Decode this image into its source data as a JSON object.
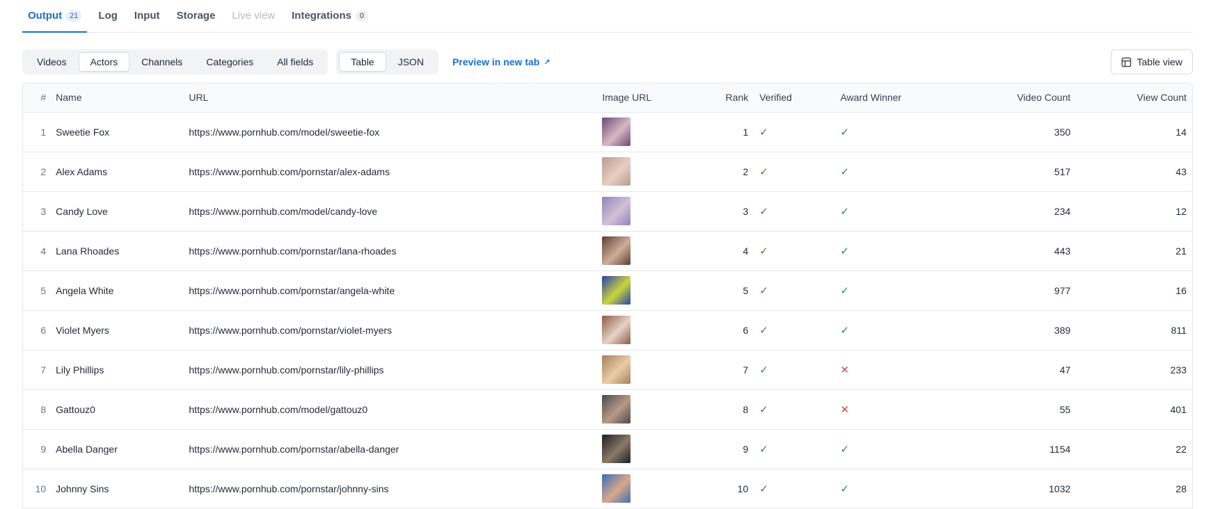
{
  "tabs": [
    {
      "label": "Output",
      "badge": "21",
      "active": true
    },
    {
      "label": "Log"
    },
    {
      "label": "Input"
    },
    {
      "label": "Storage"
    },
    {
      "label": "Live view",
      "disabled": true
    },
    {
      "label": "Integrations",
      "badge": "0"
    }
  ],
  "toolbar": {
    "views": [
      "Videos",
      "Actors",
      "Channels",
      "Categories",
      "All fields"
    ],
    "active_view": "Actors",
    "formats": [
      "Table",
      "JSON"
    ],
    "active_format": "Table",
    "preview_label": "Preview in new tab",
    "table_view_label": "Table view"
  },
  "table": {
    "columns": [
      "#",
      "Name",
      "URL",
      "Image URL",
      "Rank",
      "Verified",
      "Award Winner",
      "Video Count",
      "View Count"
    ],
    "rows": [
      {
        "idx": "1",
        "name": "Sweetie Fox",
        "url": "https://www.pornhub.com/model/sweetie-fox",
        "rank": "1",
        "verified": true,
        "award": true,
        "videos": "350",
        "views": "14",
        "thumb": [
          "#6a4a72",
          "#d9b7c4"
        ]
      },
      {
        "idx": "2",
        "name": "Alex Adams",
        "url": "https://www.pornhub.com/pornstar/alex-adams",
        "rank": "2",
        "verified": true,
        "award": true,
        "videos": "517",
        "views": "43",
        "thumb": [
          "#b89a90",
          "#e7cfc4"
        ]
      },
      {
        "idx": "3",
        "name": "Candy Love",
        "url": "https://www.pornhub.com/model/candy-love",
        "rank": "3",
        "verified": true,
        "award": true,
        "videos": "234",
        "views": "12",
        "thumb": [
          "#8f86b8",
          "#d2c0d8"
        ]
      },
      {
        "idx": "4",
        "name": "Lana Rhoades",
        "url": "https://www.pornhub.com/pornstar/lana-rhoades",
        "rank": "4",
        "verified": true,
        "award": true,
        "videos": "443",
        "views": "21",
        "thumb": [
          "#5b4036",
          "#cfae98"
        ]
      },
      {
        "idx": "5",
        "name": "Angela White",
        "url": "https://www.pornhub.com/pornstar/angela-white",
        "rank": "5",
        "verified": true,
        "award": true,
        "videos": "977",
        "views": "16",
        "thumb": [
          "#2b3fb0",
          "#c9d63a"
        ]
      },
      {
        "idx": "6",
        "name": "Violet Myers",
        "url": "https://www.pornhub.com/pornstar/violet-myers",
        "rank": "6",
        "verified": true,
        "award": true,
        "videos": "389",
        "views": "811",
        "thumb": [
          "#8a5a48",
          "#e8d2c6"
        ]
      },
      {
        "idx": "7",
        "name": "Lily Phillips",
        "url": "https://www.pornhub.com/pornstar/lily-phillips",
        "rank": "7",
        "verified": true,
        "award": false,
        "videos": "47",
        "views": "233",
        "thumb": [
          "#a8805a",
          "#e9cda8"
        ]
      },
      {
        "idx": "8",
        "name": "Gattouz0",
        "url": "https://www.pornhub.com/model/gattouz0",
        "rank": "8",
        "verified": true,
        "award": false,
        "videos": "55",
        "views": "401",
        "thumb": [
          "#4a4a4a",
          "#b89a88"
        ]
      },
      {
        "idx": "9",
        "name": "Abella Danger",
        "url": "https://www.pornhub.com/pornstar/abella-danger",
        "rank": "9",
        "verified": true,
        "award": true,
        "videos": "1154",
        "views": "22",
        "thumb": [
          "#1e1e22",
          "#8a7a6a"
        ]
      },
      {
        "idx": "10",
        "name": "Johnny Sins",
        "url": "https://www.pornhub.com/pornstar/johnny-sins",
        "rank": "10",
        "verified": true,
        "award": true,
        "videos": "1032",
        "views": "28",
        "thumb": [
          "#3a6fb8",
          "#d9a88a"
        ]
      }
    ]
  },
  "colors": {
    "accent": "#1a6fd1",
    "check": "#2b8a3e",
    "cross": "#d64545"
  }
}
